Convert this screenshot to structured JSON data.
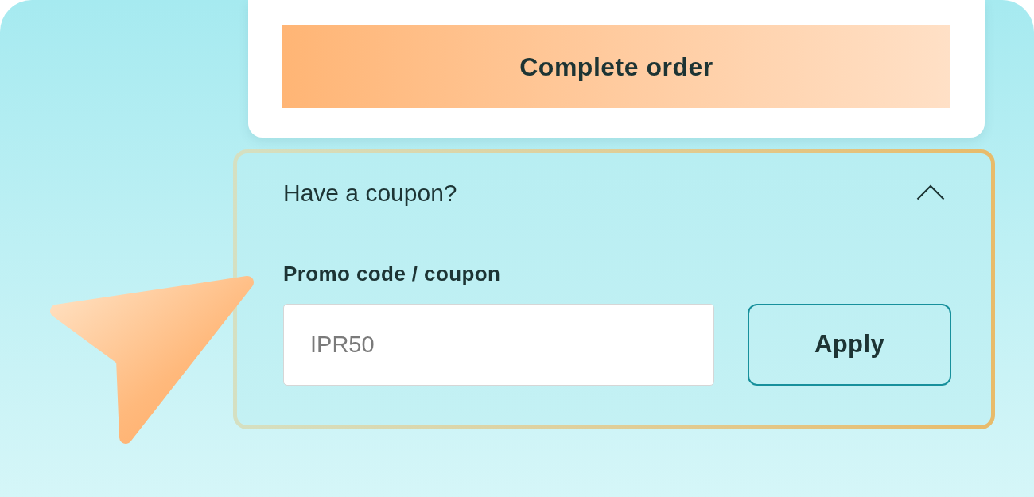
{
  "order_card": {
    "button": "Complete order"
  },
  "coupon": {
    "title": "Have a coupon?",
    "expanded": true,
    "field_label": "Promo code / coupon",
    "input": {
      "placeholder": "IPR50"
    },
    "apply_button": "Apply"
  }
}
